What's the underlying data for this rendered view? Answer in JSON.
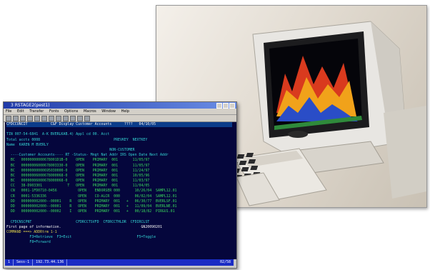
{
  "terminal": {
    "title": "3 RSTAGE2(pest1)",
    "menu": [
      "File",
      "Edit",
      "Transfer",
      "Fonts",
      "Options",
      "Macros",
      "Window",
      "Help"
    ],
    "screen_lines": [
      {
        "cls": "w hdr",
        "text": "CFDCCUNCIT           C&F Display Customer Accounts      ????   04/10/05"
      },
      {
        "cls": "c",
        "text": ""
      },
      {
        "cls": "c",
        "text": "TIN 007-54-6841  A-K BVERLKAB.4) Appl cd 00. Acct"
      },
      {
        "cls": "c",
        "text": "Total accts 0008                                   PREVKEY  NEXTKEY"
      },
      {
        "cls": "c",
        "text": "Name  KAREN M BVERLY"
      },
      {
        "cls": "c",
        "text": "                                                 NON-CUSTOMER"
      },
      {
        "cls": "c",
        "text": "  ----Customer Accounts---- RT -Status- Mngt Nat Addr IRS Open Date Next Addr"
      },
      {
        "cls": "g",
        "text": "  BC   00000000000678001D1B-0    OPEN    PRIMARY  001       11/05/97"
      },
      {
        "cls": "g",
        "text": "  BC   00000006000678003330-0    OPEN    PRIMARY  001       11/05/97"
      },
      {
        "cls": "g",
        "text": "  BC   00000000000695030000-0    OPEN    PRIMARY  001       11/24/97"
      },
      {
        "cls": "g",
        "text": "  BC   00000006000678000068-0    OPEN    PRIMARY  001       10/05/96"
      },
      {
        "cls": "g",
        "text": "  BC   00000006000678000068-0    OPEN    PRIMARY  001       11/03/97"
      },
      {
        "cls": "g",
        "text": "  CC   38-D903301            T   OPEN    PRIMARY  001       11/04/05"
      },
      {
        "cls": "g",
        "text": "  CN   0001-1FD0710-0456          OPEN    ENDORSER 000       10/26/04  SAMPL12.01"
      },
      {
        "cls": "g",
        "text": "  CR   0001-5336336               OPEN    CO-ALCR  000       06/02/04  SAMPL12.01"
      },
      {
        "cls": "g",
        "text": "  DD   000000002000--00001    R   OPEN    PRIMARY  001   +   06/30/77  BVERLSF.01"
      },
      {
        "cls": "g",
        "text": "  DD   000000002000--00001    R   OPEN    PRIMARY  001   +   11/09/04  BVERLNE.01"
      },
      {
        "cls": "g",
        "text": "  DD   000000002000--00002    I   OPEN    PRIMARY  001   +   00/18/82  PIRGU1.01"
      },
      {
        "cls": "c",
        "text": ""
      },
      {
        "cls": "c",
        "text": "  CFDCNSCPNT                     CFDRCCTSVFD  CFDRCCTHLDR  CFDIRCLST"
      },
      {
        "cls": "w",
        "text": "First page of information.                                      GN20090201"
      },
      {
        "cls": "y",
        "text": "COMMAND ===> ADDRtrm 1-1"
      },
      {
        "cls": "c",
        "text": "           F3=Retrieve  F3=Exit                               F5=Toggle"
      },
      {
        "cls": "c",
        "text": "           F8=Forward"
      }
    ],
    "status": [
      "1",
      "Sess-1",
      "192.73.44.136",
      "",
      "02/58"
    ]
  },
  "photo": {
    "subject": "color-terminal-product-photo"
  }
}
